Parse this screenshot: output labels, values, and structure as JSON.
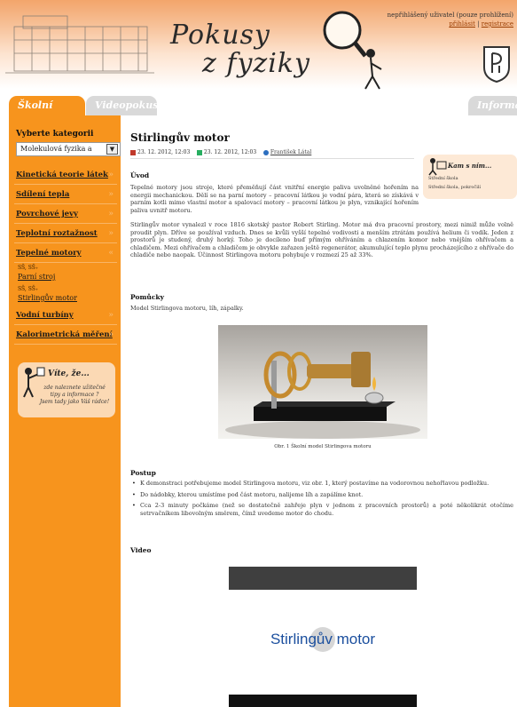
{
  "header": {
    "title_line1": "Pokusy",
    "title_line2": "z fyziky",
    "user_status": "nepřihlášený uživatel (pouze prohlížení)",
    "login_link": "přihlásit",
    "separator": "|",
    "register_link": "registrace"
  },
  "tabs": [
    "Školní pokusy",
    "Videopokusy",
    "Informace"
  ],
  "sidebar": {
    "category_label": "Vyberte kategorii",
    "category_selected": "Molekulová fyzika a",
    "menu": [
      {
        "label": "Kinetická teorie látek"
      },
      {
        "label": "Sdílení tepla"
      },
      {
        "label": "Povrchové jevy"
      },
      {
        "label": "Teplotní roztažnost"
      },
      {
        "label": "Tepelné motory"
      },
      {
        "label": "Vodní turbíny"
      },
      {
        "label": "Kalorimetrická měření"
      }
    ],
    "submenu": [
      {
        "grade": "SŠ, SŠ₊",
        "link": "Parní stroj"
      },
      {
        "grade": "SŠ, SŠ₊",
        "link": "Stirlingův motor"
      }
    ],
    "vite": {
      "title": "Víte, že...",
      "line1": "zde naleznete užitečné",
      "line2": "tipy a informace ?",
      "line3": "Jsem tady jako Váš rádce!"
    }
  },
  "article": {
    "title": "Stirlingův motor",
    "created": "23. 12. 2012, 12:03",
    "modified": "23. 12. 2012, 12:03",
    "author": "František Látal",
    "kam_title": "Kam s ním...",
    "kam_items": [
      "Střední škola",
      "Střední škola, pokročilí"
    ],
    "sections": {
      "uvod": "Úvod",
      "pomucky": "Pomůcky",
      "postup": "Postup",
      "video": "Video"
    },
    "uvod_text": "Tepelné motory jsou stroje, které přeměňují část vnitřní energie paliva uvolněné hořením na energii mechanickou. Dělí se na parní motory – pracovní látkou je vodní pára, která se získává v parním kotli mimo vlastní motor a spalovací motory – pracovní látkou je plyn, vznikající hořením paliva uvnitř motoru.",
    "stirling_text": "Stirlingův motor vynalezl v roce 1816 skotský pastor Robert Stirling. Motor má dva pracovní prostory, mezi nimiž může volně proudit plyn. Dříve se používal vzduch. Dnes se kvůli vyšší tepelné vodivosti a menším ztrátám používá helium či vodík. Jeden z prostorů je studený, druhý horký. Toho je docíleno buď přímým ohříváním a chlazením komor nebo vnějším ohřívačem a chladičem. Mezi ohřívačem a chladičem je obvykle zařazen ještě regenerátor, akumulující teplo plynu procházejícího z ohřívače do chladiče nebo naopak. Účinnost Stirlingova motoru pohybuje v rozmezí 25 až 33%.",
    "pomucky_text": "Model Stirlingova motoru, líh, zápalky.",
    "caption": "Obr. 1 Školní model Stirlingova motoru",
    "steps": [
      "K demonstraci potřebujeme model Stirlingova motoru, viz obr. 1, který postavíme na vodorovnou nehořlavou podložku.",
      "Do nádobky, kterou umístíme pod část motoru, nalijeme líh a zapálíme knot.",
      "Cca 2-3 minuty počkáme (než se dostatečně zahřeje plyn v jednom z pracovních prostorů) a poté několikrát otočíme setrvačníkem libovolným směrem, čímž uvedeme motor do chodu."
    ],
    "video_title": "Stirlingův motor"
  }
}
